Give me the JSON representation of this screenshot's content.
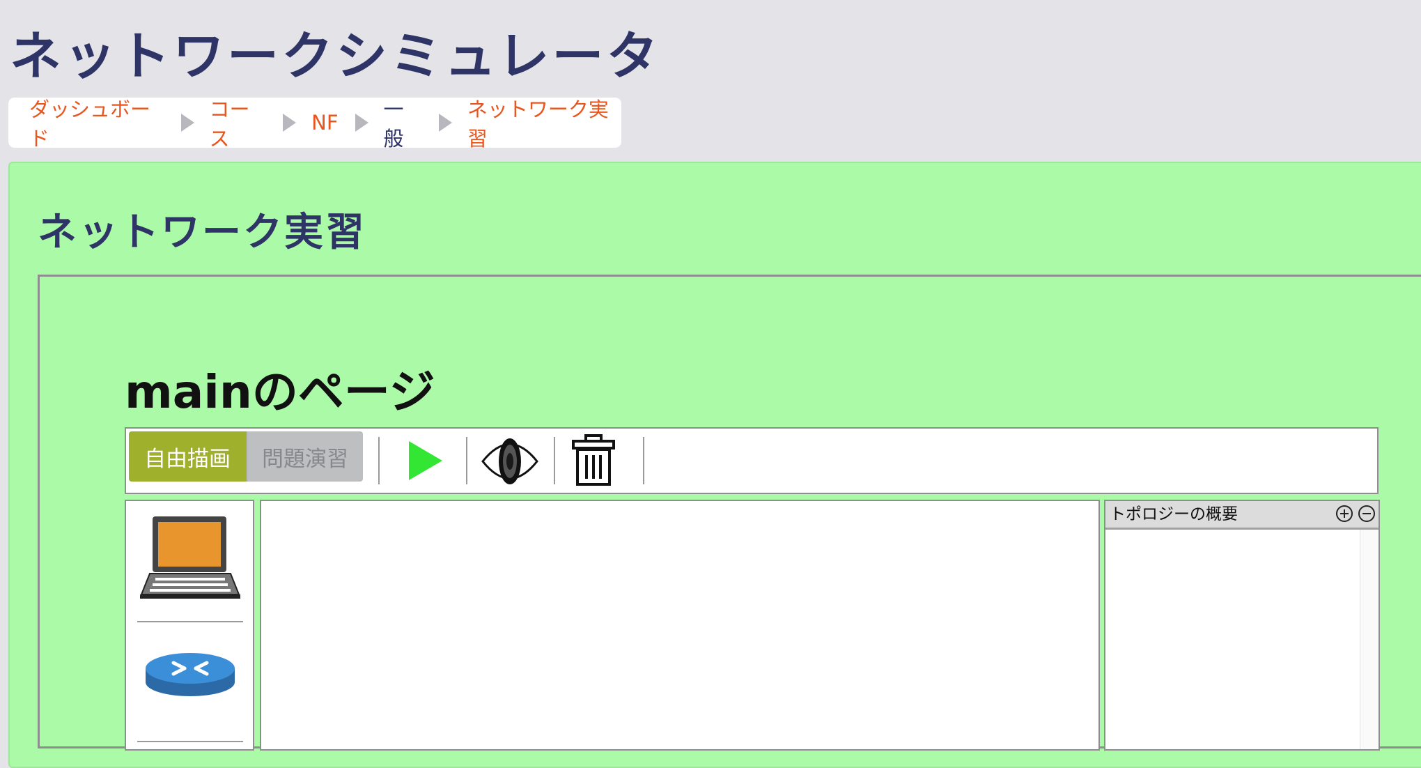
{
  "site": {
    "title": "ネットワークシミュレータ"
  },
  "breadcrumb": {
    "items": [
      {
        "label": "ダッシュボード",
        "link": true
      },
      {
        "label": "コース",
        "link": true
      },
      {
        "label": "NF",
        "link": true
      },
      {
        "label": "一般",
        "link": false
      },
      {
        "label": "ネットワーク実習",
        "link": true
      }
    ]
  },
  "activity": {
    "title": "ネットワーク実習"
  },
  "page": {
    "heading": "mainのページ"
  },
  "toolbar": {
    "modes": [
      {
        "label": "自由描画",
        "active": true
      },
      {
        "label": "問題演習",
        "active": false
      }
    ],
    "icons": [
      "play-icon",
      "eye-icon",
      "trash-icon"
    ]
  },
  "palette": {
    "items": [
      "laptop-icon",
      "router-icon"
    ]
  },
  "overview": {
    "title": "トポロジーの概要",
    "zoom_in": "⊕",
    "zoom_out": "⊖"
  },
  "colors": {
    "accent": "#e8561f",
    "title": "#2f3466",
    "panel_bg": "#abfaa7",
    "mode_active": "#9fb02c",
    "play": "#33e633",
    "laptop_screen": "#e8952e",
    "router": "#3b83c8"
  }
}
